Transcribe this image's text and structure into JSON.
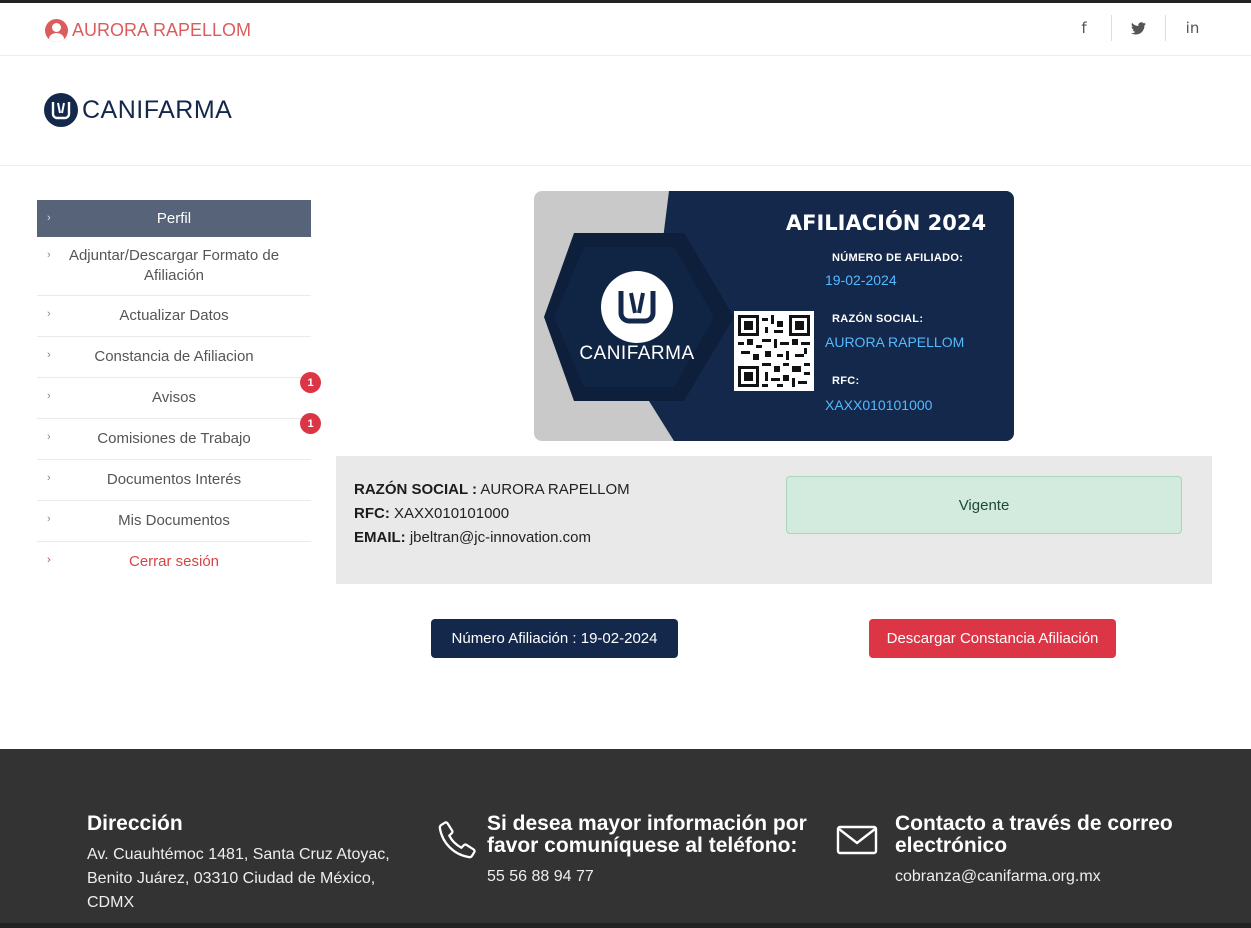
{
  "topbar": {
    "user_name": "AURORA RAPELLOM",
    "social": [
      {
        "icon": "facebook-icon",
        "glyph": "f"
      },
      {
        "icon": "twitter-icon",
        "glyph": "t"
      },
      {
        "icon": "linkedin-icon",
        "glyph": "in"
      }
    ]
  },
  "brand": {
    "logo_text": "CANIFARMA",
    "primary_color": "#13284a",
    "accent_color": "#dc3545"
  },
  "sidebar": {
    "items": [
      {
        "label": "Perfil",
        "active": true
      },
      {
        "label": "Adjuntar/Descargar Formato de Afiliación"
      },
      {
        "label": "Actualizar Datos"
      },
      {
        "label": "Constancia de Afiliacion"
      },
      {
        "label": "Avisos",
        "badge": "1"
      },
      {
        "label": "Comisiones de Trabajo",
        "badge": "1"
      },
      {
        "label": "Documentos Interés"
      },
      {
        "label": "Mis Documentos"
      },
      {
        "label": "Cerrar sesión"
      }
    ]
  },
  "card": {
    "title": "AFILIACIÓN 2024",
    "logo_text": "CANIFARMA",
    "numero_label": "NÚMERO DE AFILIADO:",
    "numero_value": "19-02-2024",
    "razon_label": "RAZÓN SOCIAL:",
    "razon_value": "AURORA RAPELLOM",
    "rfc_label": "RFC:",
    "rfc_value": "XAXX010101000"
  },
  "profile": {
    "razon_label": "RAZÓN SOCIAL :",
    "razon_value": "AURORA RAPELLOM",
    "rfc_label": "RFC:",
    "rfc_value": "XAXX010101000",
    "email_label": "EMAIL:",
    "email_value": "jbeltran@jc-innovation.com",
    "status": "Vigente"
  },
  "actions": {
    "numero_button": "Número Afiliación : 19-02-2024",
    "download_button": "Descargar Constancia Afiliación"
  },
  "footer": {
    "address_title": "Dirección",
    "address_text": "Av. Cuauhtémoc 1481, Santa Cruz Atoyac, Benito Juárez, 03310 Ciudad de México, CDMX",
    "phone_title": "Si desea mayor información por favor comuníquese al teléfono:",
    "phone_value": "55 56 88 94 77",
    "email_title": "Contacto a través de correo electrónico",
    "email_value": "cobranza@canifarma.org.mx"
  }
}
